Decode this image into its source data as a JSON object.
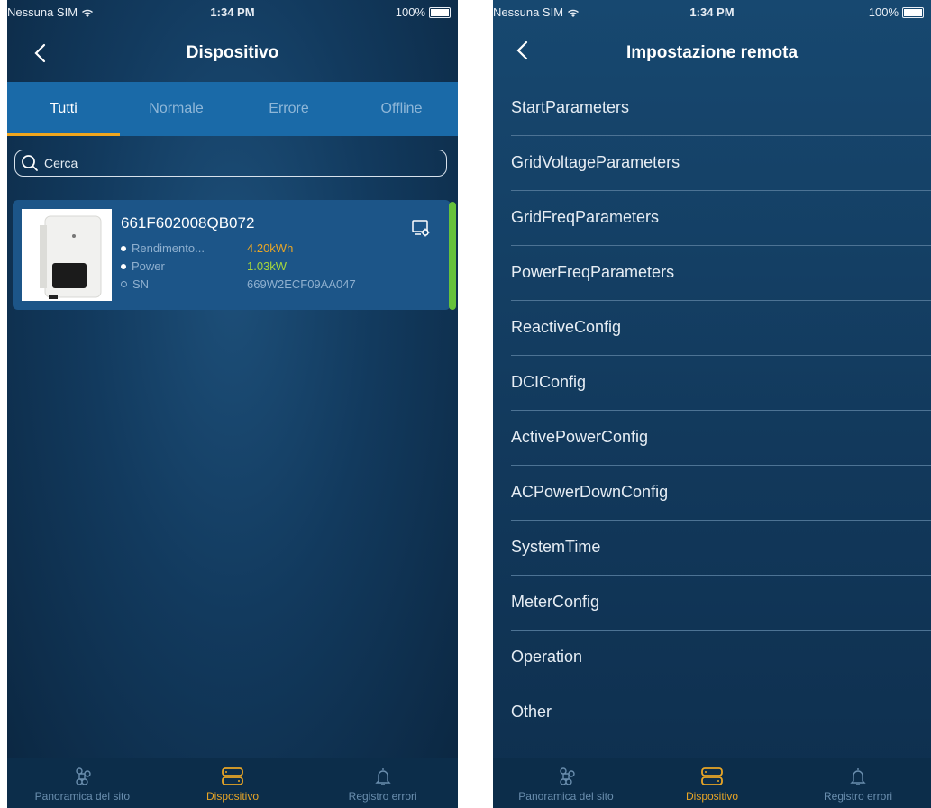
{
  "left": {
    "status": {
      "carrier": "Nessuna SIM",
      "time": "1:34 PM",
      "battery": "100%"
    },
    "title": "Dispositivo",
    "tabs": [
      "Tutti",
      "Normale",
      "Errore",
      "Offline"
    ],
    "active_tab": "Tutti",
    "search": {
      "placeholder": "Cerca"
    },
    "device": {
      "name": "661F602008QB072",
      "yield_label": "Rendimento...",
      "yield_value": "4.20kWh",
      "power_label": "Power",
      "power_value": "1.03kW",
      "sn_label": "SN",
      "sn_value": "669W2ECF09AA047"
    },
    "bottom": [
      "Panoramica del sito",
      "Dispositivo",
      "Registro errori"
    ]
  },
  "right": {
    "status": {
      "carrier": "Nessuna SIM",
      "time": "1:34 PM",
      "battery": "100%"
    },
    "title": "Impostazione remota",
    "items": [
      "StartParameters",
      "GridVoltageParameters",
      "GridFreqParameters",
      "PowerFreqParameters",
      "ReactiveConfig",
      "DCIConfig",
      "ActivePowerConfig",
      "ACPowerDownConfig",
      "SystemTime",
      "MeterConfig",
      "Operation",
      "Other"
    ],
    "bottom": [
      "Panoramica del sito",
      "Dispositivo",
      "Registro errori"
    ]
  },
  "colors": {
    "accent": "#f0a61e",
    "tab_bar": "#1a6aa8",
    "online": "#66c23b"
  }
}
